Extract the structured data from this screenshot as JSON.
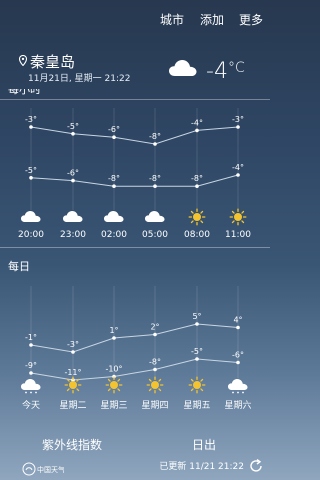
{
  "header": {
    "menu": [
      "城市",
      "添加",
      "更多"
    ]
  },
  "location": {
    "city": "秦皇岛",
    "date": "11月21日, 星期一 21:22"
  },
  "current": {
    "temp": "-4",
    "unit": "°C",
    "icon": "cloud-icon"
  },
  "hourly_section_cut_label": "每小时",
  "hourly": {
    "times": [
      "20:00",
      "23:00",
      "02:00",
      "05:00",
      "08:00",
      "11:00"
    ],
    "icons": [
      "cloud-icon",
      "cloud-icon",
      "cloud-icon",
      "cloud-icon",
      "sun-icon",
      "sun-icon"
    ],
    "high": [
      -3,
      -5,
      -6,
      -8,
      -4,
      -3
    ],
    "low": [
      -5,
      -6,
      -8,
      -8,
      -8,
      -4
    ]
  },
  "daily": {
    "label": "每日",
    "days": [
      "今天",
      "星期二",
      "星期三",
      "星期四",
      "星期五",
      "星期六"
    ],
    "icons": [
      "snow-cloud-icon",
      "sun-icon",
      "sun-icon",
      "sun-icon",
      "sun-icon",
      "snow-cloud-icon"
    ],
    "high": [
      -1,
      -3,
      1,
      2,
      5,
      4
    ],
    "low": [
      -9,
      -11,
      -10,
      -8,
      -5,
      -6
    ]
  },
  "tiles": {
    "uv": "紫外线指数",
    "sunrise": "日出"
  },
  "footer": {
    "logo": "中国天气",
    "updated": "已更新 11/21  21:22"
  },
  "colors": {
    "sun": "#f4c430",
    "line": "#c9d6e3"
  }
}
